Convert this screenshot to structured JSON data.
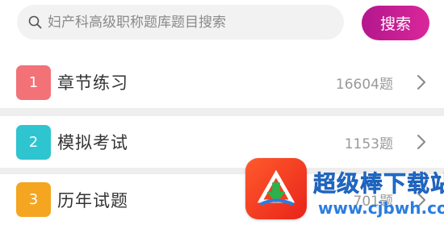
{
  "search": {
    "placeholder": "妇产科高级职称题库题目搜索",
    "button_label": "搜索"
  },
  "colors": {
    "search_button": "#c21a93",
    "badge_1": "#f27278",
    "badge_2": "#2ec4d0",
    "badge_3": "#f4a620",
    "watermark_text": "#2a7de0",
    "watermark_logo": "#f0401e"
  },
  "rows": [
    {
      "number": "1",
      "title": "章节练习",
      "count": "16604题",
      "icon": "chevron-right-icon"
    },
    {
      "number": "2",
      "title": "模拟考试",
      "count": "1153题",
      "icon": "chevron-right-icon"
    },
    {
      "number": "3",
      "title": "历年试题",
      "count": "701题",
      "icon": "chevron-right-icon"
    }
  ],
  "watermark": {
    "title": "超级棒下载站",
    "url": "www.cjbwh.com"
  }
}
